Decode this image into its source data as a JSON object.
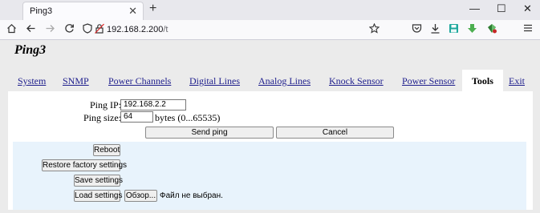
{
  "browser": {
    "tab_title": "Ping3",
    "tab_close": "✕",
    "new_tab": "+",
    "window_controls": {
      "minimize": "—",
      "maximize": "☐",
      "close": "✕"
    },
    "url_host": "192.168.2.200",
    "url_path": "/t",
    "icons": [
      "home-icon",
      "back-icon",
      "forward-icon",
      "reload-icon",
      "shield-icon",
      "lock-icon",
      "bookmark-star-icon",
      "pocket-icon",
      "download-icon",
      "save-icon",
      "extension-arrow-icon",
      "extension-gem-icon",
      "menu-icon"
    ]
  },
  "page": {
    "title": "Ping3",
    "nav": [
      "System",
      "SNMP",
      "Power Channels",
      "Digital Lines",
      "Analog Lines",
      "Knock Sensor",
      "Power Sensor",
      "Tools",
      "Exit"
    ],
    "active_nav": "Tools",
    "ping": {
      "ip_label": "Ping IP:",
      "ip_value": "192.168.2.2",
      "size_label": "Ping size:",
      "size_value": "64",
      "size_hint": "bytes (0...65535)",
      "send_button": "Send ping",
      "cancel_button": "Cancel"
    },
    "service": {
      "reboot_button": "Reboot",
      "restore_button": "Restore factory settings",
      "save_button": "Save settings",
      "load_button": "Load settings",
      "browse_button": "Обзор...",
      "file_status": "Файл не выбран."
    }
  }
}
